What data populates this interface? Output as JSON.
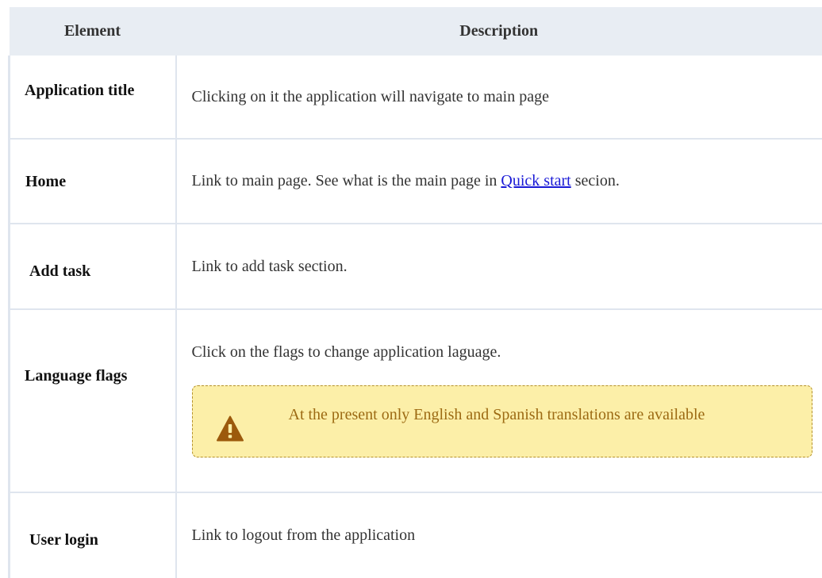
{
  "table": {
    "headers": {
      "element": "Element",
      "description": "Description"
    },
    "rows": [
      {
        "element": "Application title",
        "description": "Clicking on it the application will navigate to main page"
      },
      {
        "element": "Home",
        "description_before": "Link to main page. See what is the main page in ",
        "link_text": "Quick start",
        "description_after": " secion."
      },
      {
        "element": "Add task",
        "description": "Link to add task section."
      },
      {
        "element": "Language flags",
        "description": "Click on the flags to change application laguage.",
        "warning": "At the present only English and Spanish translations are available"
      },
      {
        "element": "User login",
        "description": "Link to logout from the application"
      }
    ]
  },
  "colors": {
    "header_bg": "#e8edf3",
    "warning_bg": "#fcefa8",
    "warning_text": "#9c6a13",
    "warning_icon": "#9c5a0c",
    "link": "#1a1ad6"
  },
  "icons": {
    "warning": "warning-triangle-icon"
  }
}
